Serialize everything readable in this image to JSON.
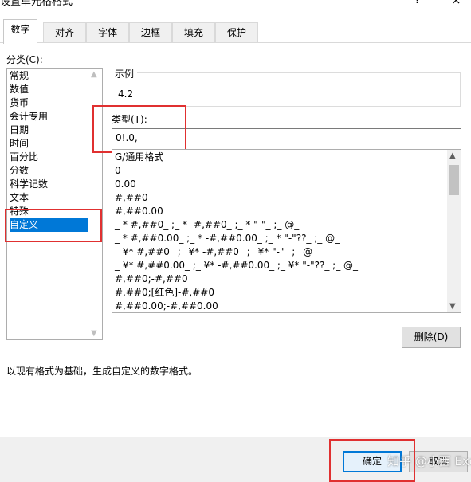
{
  "window": {
    "title": "设置单元格格式",
    "help_glyph": "?",
    "close_glyph": "×"
  },
  "tabs": [
    {
      "label": "数字",
      "active": true
    },
    {
      "label": "对齐",
      "active": false
    },
    {
      "label": "字体",
      "active": false
    },
    {
      "label": "边框",
      "active": false
    },
    {
      "label": "填充",
      "active": false
    },
    {
      "label": "保护",
      "active": false
    }
  ],
  "category": {
    "label": "分类(C):",
    "items": [
      "常规",
      "数值",
      "货币",
      "会计专用",
      "日期",
      "时间",
      "百分比",
      "分数",
      "科学记数",
      "文本",
      "特殊",
      "自定义"
    ],
    "selected": "自定义"
  },
  "sample": {
    "label": "示例",
    "value": "4.2"
  },
  "type": {
    "label": "类型(T):",
    "value": "0!.0,"
  },
  "formats": [
    "G/通用格式",
    "0",
    "0.00",
    "#,##0",
    "#,##0.00",
    "_ * #,##0_ ;_ * -#,##0_ ;_ * \"-\"_ ;_ @_",
    "_ * #,##0.00_ ;_ * -#,##0.00_ ;_ * \"-\"??_ ;_ @_",
    "_ ¥* #,##0_ ;_ ¥* -#,##0_ ;_ ¥* \"-\"_ ;_ @_",
    "_ ¥* #,##0.00_ ;_ ¥* -#,##0.00_ ;_ ¥* \"-\"??_ ;_ @_",
    "#,##0;-#,##0",
    "#,##0;[红色]-#,##0",
    "#,##0.00;-#,##0.00"
  ],
  "buttons": {
    "delete": "删除(D)",
    "ok": "确定",
    "cancel": "取消"
  },
  "description": "以现有格式为基础，生成自定义的数字格式。",
  "watermark": "知乎 @小西 Excel",
  "colors": {
    "selection": "#0078d7",
    "highlight_box": "#e03030"
  }
}
